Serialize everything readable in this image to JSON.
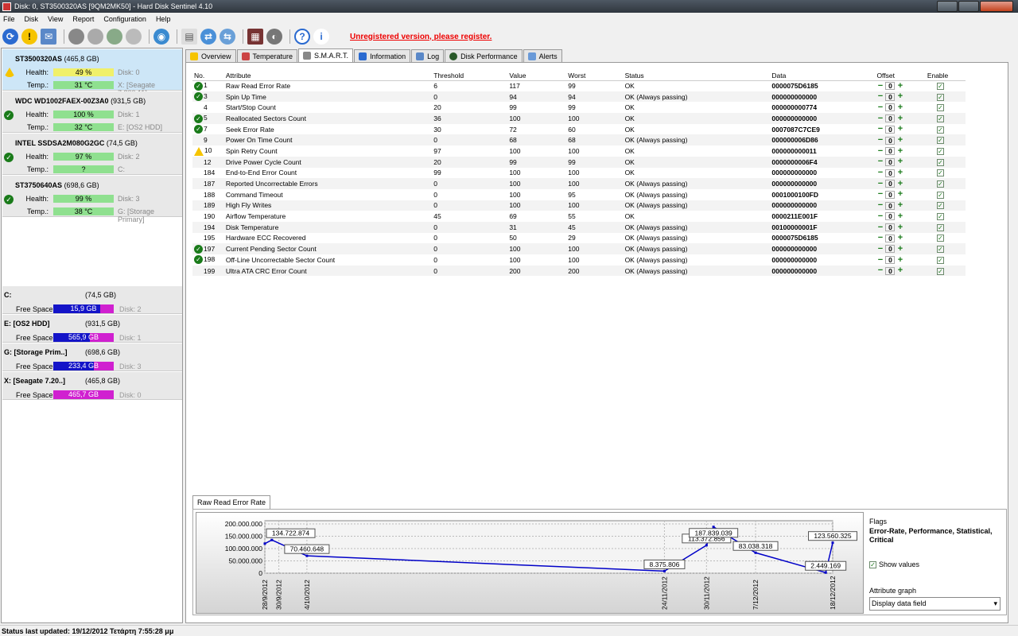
{
  "window": {
    "title": "Disk: 0, ST3500320AS [9QM2MK50]  -  Hard Disk Sentinel 4.10"
  },
  "menu": [
    "File",
    "Disk",
    "View",
    "Report",
    "Configuration",
    "Help"
  ],
  "toolbar": {
    "unregistered": "Unregistered version, please register."
  },
  "disks": [
    {
      "name": "ST3500320AS",
      "size": "(465,8 GB)",
      "health": "49 %",
      "temp": "31 °C",
      "disk": "Disk: 0",
      "volume": "X: [Seagate 7.200,11]",
      "status": "warn",
      "health_fraction": 0.49,
      "bar_color": "#f0f06a"
    },
    {
      "name": "WDC WD1002FAEX-00Z3A0",
      "size": "(931,5 GB)",
      "health": "100 %",
      "temp": "32 °C",
      "disk": "Disk: 1",
      "volume": "E: [OS2 HDD]",
      "status": "ok",
      "health_fraction": 1.0,
      "bar_color": "#8fe08f"
    },
    {
      "name": "INTEL SSDSA2M080G2GC",
      "size": "(74,5 GB)",
      "health": "97 %",
      "temp": "?",
      "disk": "Disk: 2",
      "volume": "C:",
      "status": "ok",
      "health_fraction": 0.97,
      "bar_color": "#8fe08f"
    },
    {
      "name": "ST3750640AS",
      "size": "(698,6 GB)",
      "health": "99 %",
      "temp": "38 °C",
      "disk": "Disk: 3",
      "volume": "G: [Storage Primary]",
      "status": "ok",
      "health_fraction": 0.99,
      "bar_color": "#8fe08f"
    }
  ],
  "labels": {
    "health": "Health:",
    "temp": "Temp.:",
    "free_space": "Free Space"
  },
  "volumes": [
    {
      "name": "C:",
      "size": "(74,5 GB)",
      "free": "15,9 GB",
      "disk": "Disk: 2",
      "used_fraction": 0.22
    },
    {
      "name": "E: [OS2 HDD]",
      "size": "(931,5 GB)",
      "free": "565,9 GB",
      "disk": "Disk: 1",
      "used_fraction": 0.6
    },
    {
      "name": "G: [Storage Prim..]",
      "size": "(698,6 GB)",
      "free": "233,4 GB",
      "disk": "Disk: 3",
      "used_fraction": 0.67
    },
    {
      "name": "X: [Seagate 7.20..]",
      "size": "(465,8 GB)",
      "free": "465,7 GB",
      "disk": "Disk: 0",
      "used_fraction": 0.0
    }
  ],
  "tabs": [
    {
      "label": "Overview",
      "icon": "warning-icon",
      "color": "#f6c400"
    },
    {
      "label": "Temperature",
      "icon": "thermometer-icon",
      "color": "#c44"
    },
    {
      "label": "S.M.A.R.T.",
      "icon": "smart-icon",
      "color": "#888"
    },
    {
      "label": "Information",
      "icon": "info-icon",
      "color": "#2a6ad0"
    },
    {
      "label": "Log",
      "icon": "log-icon",
      "color": "#5a88c8"
    },
    {
      "label": "Disk Performance",
      "icon": "performance-icon",
      "color": "#2a5a2a"
    },
    {
      "label": "Alerts",
      "icon": "alerts-icon",
      "color": "#6a9ad8"
    }
  ],
  "smart_headers": [
    "No.",
    "Attribute",
    "Threshold",
    "Value",
    "Worst",
    "Status",
    "Data",
    "Offset",
    "Enable"
  ],
  "smart_rows": [
    {
      "no": "1",
      "attr": "Raw Read Error Rate",
      "thr": "6",
      "val": "117",
      "worst": "99",
      "status": "OK",
      "data": "0000075D6185",
      "offset": "0",
      "icon": "ok"
    },
    {
      "no": "3",
      "attr": "Spin Up Time",
      "thr": "0",
      "val": "94",
      "worst": "94",
      "status": "OK (Always passing)",
      "data": "000000000000",
      "offset": "0",
      "icon": "ok"
    },
    {
      "no": "4",
      "attr": "Start/Stop Count",
      "thr": "20",
      "val": "99",
      "worst": "99",
      "status": "OK",
      "data": "000000000774",
      "offset": "0",
      "icon": ""
    },
    {
      "no": "5",
      "attr": "Reallocated Sectors Count",
      "thr": "36",
      "val": "100",
      "worst": "100",
      "status": "OK",
      "data": "000000000000",
      "offset": "0",
      "icon": "ok"
    },
    {
      "no": "7",
      "attr": "Seek Error Rate",
      "thr": "30",
      "val": "72",
      "worst": "60",
      "status": "OK",
      "data": "0007087C7CE9",
      "offset": "0",
      "icon": "ok"
    },
    {
      "no": "9",
      "attr": "Power On Time Count",
      "thr": "0",
      "val": "68",
      "worst": "68",
      "status": "OK (Always passing)",
      "data": "000000006D86",
      "offset": "0",
      "icon": ""
    },
    {
      "no": "10",
      "attr": "Spin Retry Count",
      "thr": "97",
      "val": "100",
      "worst": "100",
      "status": "OK",
      "data": "000000000011",
      "offset": "0",
      "icon": "warn"
    },
    {
      "no": "12",
      "attr": "Drive Power Cycle Count",
      "thr": "20",
      "val": "99",
      "worst": "99",
      "status": "OK",
      "data": "0000000006F4",
      "offset": "0",
      "icon": ""
    },
    {
      "no": "184",
      "attr": "End-to-End Error Count",
      "thr": "99",
      "val": "100",
      "worst": "100",
      "status": "OK",
      "data": "000000000000",
      "offset": "0",
      "icon": ""
    },
    {
      "no": "187",
      "attr": "Reported Uncorrectable Errors",
      "thr": "0",
      "val": "100",
      "worst": "100",
      "status": "OK (Always passing)",
      "data": "000000000000",
      "offset": "0",
      "icon": ""
    },
    {
      "no": "188",
      "attr": "Command Timeout",
      "thr": "0",
      "val": "100",
      "worst": "95",
      "status": "OK (Always passing)",
      "data": "0001000100FD",
      "offset": "0",
      "icon": ""
    },
    {
      "no": "189",
      "attr": "High Fly Writes",
      "thr": "0",
      "val": "100",
      "worst": "100",
      "status": "OK (Always passing)",
      "data": "000000000000",
      "offset": "0",
      "icon": ""
    },
    {
      "no": "190",
      "attr": "Airflow Temperature",
      "thr": "45",
      "val": "69",
      "worst": "55",
      "status": "OK",
      "data": "0000211E001F",
      "offset": "0",
      "icon": ""
    },
    {
      "no": "194",
      "attr": "Disk Temperature",
      "thr": "0",
      "val": "31",
      "worst": "45",
      "status": "OK (Always passing)",
      "data": "00100000001F",
      "offset": "0",
      "icon": ""
    },
    {
      "no": "195",
      "attr": "Hardware ECC Recovered",
      "thr": "0",
      "val": "50",
      "worst": "29",
      "status": "OK (Always passing)",
      "data": "0000075D6185",
      "offset": "0",
      "icon": ""
    },
    {
      "no": "197",
      "attr": "Current Pending Sector Count",
      "thr": "0",
      "val": "100",
      "worst": "100",
      "status": "OK (Always passing)",
      "data": "000000000000",
      "offset": "0",
      "icon": "ok"
    },
    {
      "no": "198",
      "attr": "Off-Line Uncorrectable Sector Count",
      "thr": "0",
      "val": "100",
      "worst": "100",
      "status": "OK (Always passing)",
      "data": "000000000000",
      "offset": "0",
      "icon": "ok"
    },
    {
      "no": "199",
      "attr": "Ultra ATA CRC Error Count",
      "thr": "0",
      "val": "200",
      "worst": "200",
      "status": "OK (Always passing)",
      "data": "000000000000",
      "offset": "0",
      "icon": ""
    }
  ],
  "graph": {
    "tab_label": "Raw Read Error Rate",
    "flags_label": "Flags",
    "flags_value": "Error-Rate, Performance, Statistical, Critical",
    "show_values_label": "Show values",
    "attr_graph_label": "Attribute graph",
    "attr_graph_value": "Display data field"
  },
  "chart_data": {
    "type": "line",
    "x": [
      "28/9/2012",
      "30/9/2012",
      "4/10/2012",
      "24/11/2012",
      "30/11/2012",
      "7/12/2012",
      "18/12/2012"
    ],
    "points": [
      {
        "date": "28/9/2012",
        "y": 120000000,
        "label": ""
      },
      {
        "date": "29/9/2012",
        "y": 134722874,
        "label": "134.722.874"
      },
      {
        "date": "4/10/2012",
        "y": 70460648,
        "label": "70.460.648"
      },
      {
        "date": "24/11/2012",
        "y": 8375806,
        "label": "8.375.806"
      },
      {
        "date": "30/11/2012",
        "y": 113372856,
        "label": "113.372.856"
      },
      {
        "date": "1/12/2012",
        "y": 187839039,
        "label": "187.839.039"
      },
      {
        "date": "7/12/2012",
        "y": 83038318,
        "label": "83.038.318"
      },
      {
        "date": "17/12/2012",
        "y": 2449169,
        "label": "2.449.169"
      },
      {
        "date": "18/12/2012",
        "y": 123560325,
        "label": "123.560.325"
      }
    ],
    "ylim": [
      0,
      200000000
    ],
    "yticks": [
      "200.000.000",
      "150.000.000",
      "100.000.000",
      "50.000.000",
      "0"
    ],
    "ytick_values": [
      200000000,
      150000000,
      100000000,
      50000000,
      0
    ],
    "xlim": [
      "28/9/2012",
      "18/12/2012"
    ],
    "grid": true,
    "color": "#0000c8"
  },
  "status_bar": "Status last updated: 19/12/2012 Τετάρτη 7:55:28 μμ"
}
